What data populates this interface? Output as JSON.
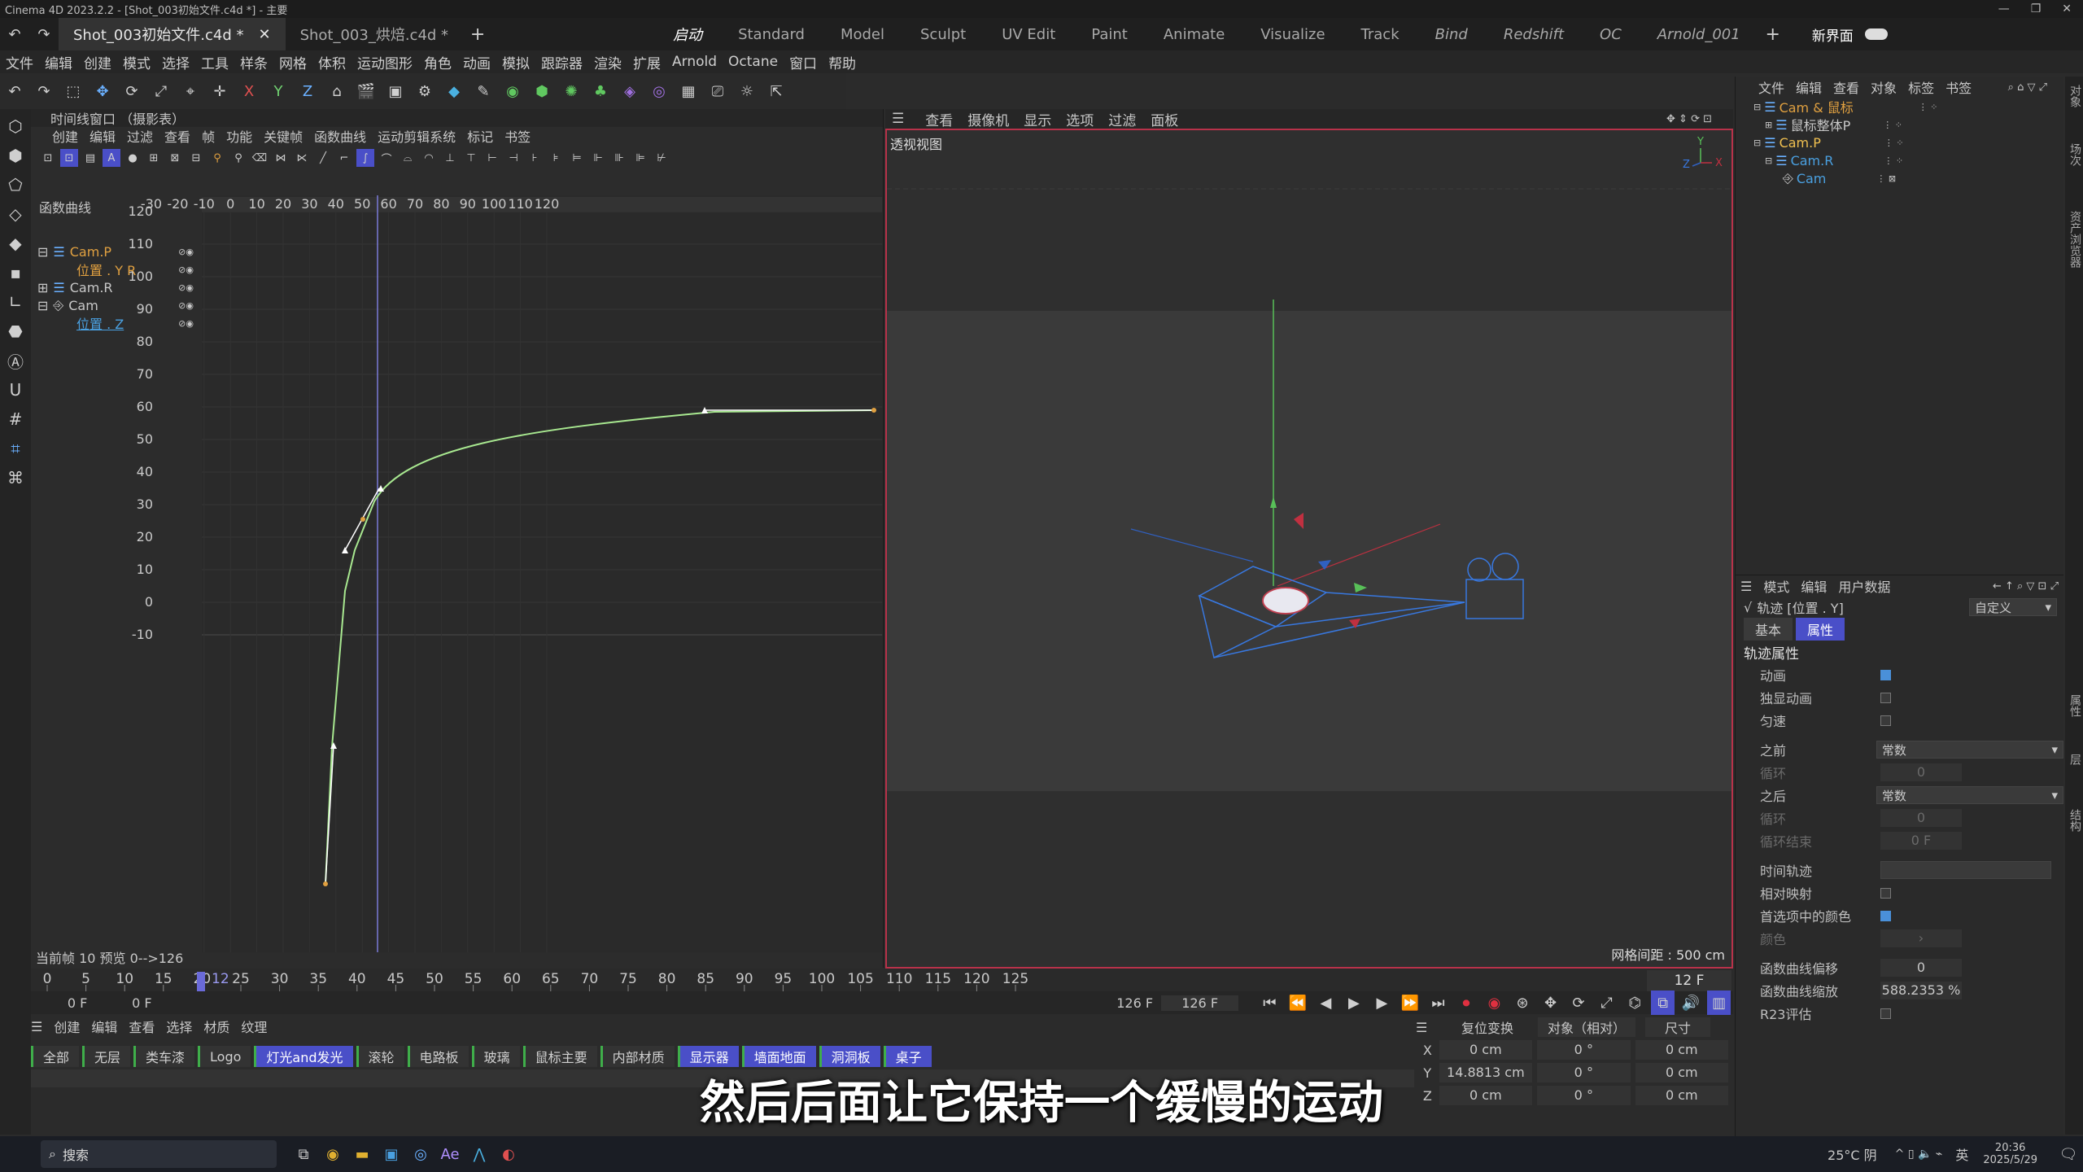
{
  "window": {
    "title": "Cinema 4D 2023.2.2 - [Shot_003初始文件.c4d *] - 主要"
  },
  "doc_tabs": [
    {
      "label": "Shot_003初始文件.c4d *",
      "active": true
    },
    {
      "label": "Shot_003_烘焙.c4d *",
      "active": false
    }
  ],
  "layouts": [
    "启动",
    "Standard",
    "Model",
    "Sculpt",
    "UV Edit",
    "Paint",
    "Animate",
    "Visualize",
    "Track",
    "Bind",
    "Redshift",
    "OC",
    "Arnold_001"
  ],
  "new_layout_label": "新界面",
  "main_menu": [
    "文件",
    "编辑",
    "创建",
    "模式",
    "选择",
    "工具",
    "样条",
    "网格",
    "体积",
    "运动图形",
    "角色",
    "动画",
    "模拟",
    "跟踪器",
    "渲染",
    "扩展",
    "Arnold",
    "Octane",
    "窗口",
    "帮助"
  ],
  "timeline": {
    "title": "时间线窗口 （摄影表）",
    "menu": [
      "创建",
      "编辑",
      "过滤",
      "查看",
      "帧",
      "功能",
      "关键帧",
      "函数曲线",
      "运动剪辑系统",
      "标记",
      "书签"
    ],
    "section_label": "函数曲线",
    "tree": [
      {
        "label": "Cam.P",
        "color": "#e0a040"
      },
      {
        "label": "位置 . Y  R",
        "color": "#e0a040",
        "indent": 1
      },
      {
        "label": "Cam.R",
        "color": "#c8c8c8"
      },
      {
        "label": "Cam",
        "color": "#c8c8c8"
      },
      {
        "label": "位置 . Z",
        "color": "#4aa0e0",
        "indent": 1
      }
    ],
    "ruler_ticks": [
      "-30",
      "-20",
      "-10",
      "0",
      "10",
      "20",
      "30",
      "40",
      "50",
      "60",
      "70",
      "80",
      "90",
      "100",
      "110",
      "120"
    ],
    "y_ticks": [
      "120",
      "110",
      "100",
      "90",
      "80",
      "70",
      "60",
      "50",
      "40",
      "30",
      "20",
      "10",
      "0",
      "-10"
    ],
    "status": "当前帧  10  预览  0-->126"
  },
  "viewport": {
    "menu": [
      "查看",
      "摄像机",
      "显示",
      "选项",
      "过滤",
      "面板"
    ],
    "title": "透视视图",
    "grid_info": "网格间距 : 500 cm"
  },
  "object_manager": {
    "menu": [
      "文件",
      "编辑",
      "查看",
      "对象",
      "标签",
      "书签"
    ],
    "objects": [
      {
        "label": "Cam & 鼠标",
        "color": "#e0a040",
        "indent": 0
      },
      {
        "label": "鼠标整体P",
        "color": "#c8c8c8",
        "indent": 1
      },
      {
        "label": "Cam.P",
        "color": "#f0c050",
        "indent": 0
      },
      {
        "label": "Cam.R",
        "color": "#4aa0e0",
        "indent": 1
      },
      {
        "label": "Cam",
        "color": "#4aa0e0",
        "indent": 2
      }
    ]
  },
  "attributes": {
    "menu": [
      "模式",
      "编辑",
      "用户数据"
    ],
    "track_title": "轨迹 [位置 . Y]",
    "preset": "自定义",
    "tabs": [
      "基本",
      "属性"
    ],
    "section": "轨迹属性",
    "rows": [
      {
        "label": "动画",
        "type": "check",
        "checked": true
      },
      {
        "label": "独显动画",
        "type": "check",
        "checked": false
      },
      {
        "label": "匀速",
        "type": "check",
        "checked": false
      },
      {
        "label": "之前",
        "type": "dropdown",
        "value": "常数"
      },
      {
        "label": "循环",
        "type": "num",
        "value": "0",
        "dim": true
      },
      {
        "label": "之后",
        "type": "dropdown",
        "value": "常数"
      },
      {
        "label": "循环",
        "type": "num",
        "value": "0",
        "dim": true
      },
      {
        "label": "循环结束",
        "type": "num",
        "value": "0 F",
        "dim": true
      },
      {
        "label": "时间轨迹",
        "type": "field",
        "value": ""
      },
      {
        "label": "相对映射",
        "type": "check",
        "checked": false
      },
      {
        "label": "首选项中的颜色",
        "type": "check",
        "checked": true
      },
      {
        "label": "颜色",
        "type": "text",
        "value": "›",
        "dim": true
      },
      {
        "label": "函数曲线偏移",
        "type": "num",
        "value": "0"
      },
      {
        "label": "函数曲线缩放",
        "type": "num",
        "value": "588.2353 %"
      },
      {
        "label": "R23评估",
        "type": "check",
        "checked": false
      }
    ]
  },
  "frame_ruler": {
    "ticks": [
      "0",
      "5",
      "10",
      "15",
      "20",
      "25",
      "30",
      "35",
      "40",
      "45",
      "50",
      "55",
      "60",
      "65",
      "70",
      "75",
      "80",
      "85",
      "90",
      "95",
      "100",
      "105",
      "110",
      "115",
      "120",
      "125"
    ],
    "current_frame_label": "12",
    "end_label": "12 F"
  },
  "transport": {
    "start": "0 F",
    "preview_start": "0 F",
    "preview_end": "126 F",
    "end": "126 F"
  },
  "materials": {
    "menu": [
      "创建",
      "编辑",
      "查看",
      "选择",
      "材质",
      "纹理"
    ],
    "tabs": [
      {
        "label": "全部",
        "blue": false
      },
      {
        "label": "无层",
        "blue": false
      },
      {
        "label": "类车漆",
        "blue": false
      },
      {
        "label": "Logo",
        "blue": false
      },
      {
        "label": "灯光and发光",
        "blue": true
      },
      {
        "label": "滚轮",
        "blue": false
      },
      {
        "label": "电路板",
        "blue": false
      },
      {
        "label": "玻璃",
        "blue": false
      },
      {
        "label": "鼠标主要",
        "blue": false
      },
      {
        "label": "内部材质",
        "blue": false
      },
      {
        "label": "显示器",
        "blue": true
      },
      {
        "label": "墙面地面",
        "blue": true
      },
      {
        "label": "洞洞板",
        "blue": true
      },
      {
        "label": "桌子",
        "blue": true
      }
    ]
  },
  "coordinates": {
    "header": [
      "复位变换",
      "对象（相对）",
      "尺寸"
    ],
    "rows": [
      {
        "axis": "X",
        "pos": "0 cm",
        "rot": "0 °",
        "size": "0 cm"
      },
      {
        "axis": "Y",
        "pos": "14.8813 cm",
        "rot": "0 °",
        "size": "0 cm"
      },
      {
        "axis": "Z",
        "pos": "0 cm",
        "rot": "0 °",
        "size": "0 cm"
      }
    ]
  },
  "subtitle": "然后后面让它保持一个缓慢的运动",
  "right_strip": [
    "对象",
    "场次",
    "资产浏览器",
    "属性",
    "层",
    "结构"
  ],
  "taskbar": {
    "search_placeholder": "搜索",
    "weather": "25°C 阴",
    "ime": "英",
    "time": "20:36",
    "date": "2025/5/29"
  },
  "accent_colors": {
    "viewport_border": "#b8324a",
    "curve": "#a8e890",
    "selected_tab": "#4a4fc8"
  }
}
